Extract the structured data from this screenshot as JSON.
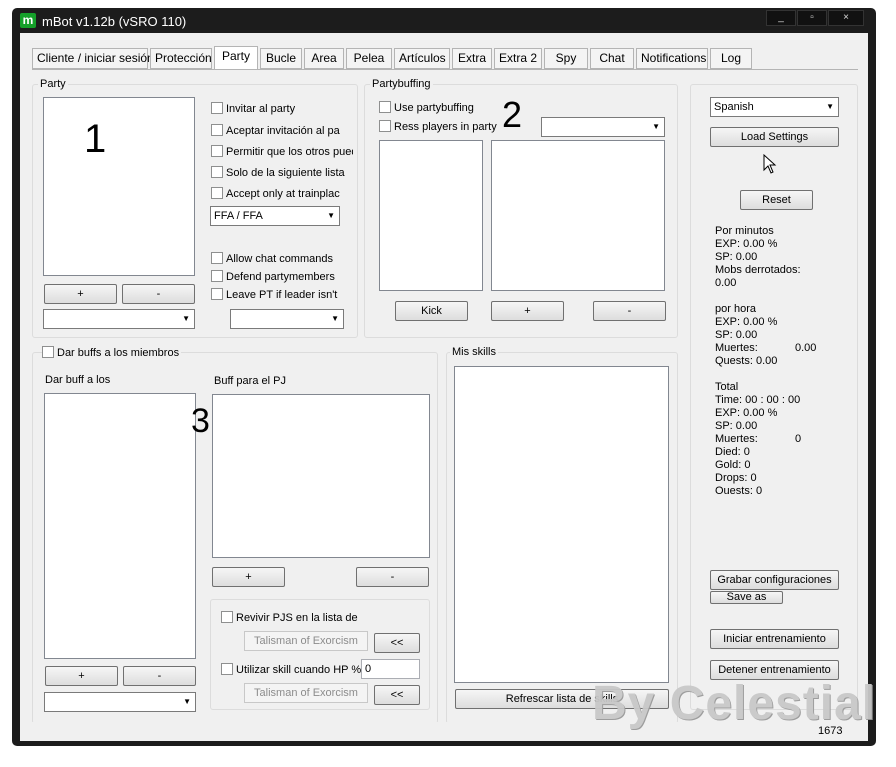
{
  "window": {
    "title": "mBot v1.12b (vSRO 110)",
    "logo": "m",
    "minimize": "_",
    "maximize": "▫",
    "close": "×"
  },
  "tabs": [
    "Cliente / iniciar sesión",
    "Protección",
    "Party",
    "Bucle",
    "Area",
    "Pelea",
    "Artículos",
    "Extra",
    "Extra 2",
    "Spy",
    "Chat",
    "Notifications",
    "Log"
  ],
  "party": {
    "group_label": "Party",
    "list_marker": "1",
    "checkboxes": [
      "Invitar al party",
      "Aceptar invitación al pa",
      "Permitir que los otros pued",
      "Solo de la siguiente lista",
      "Accept only at trainplac"
    ],
    "mode": "FFA / FFA",
    "checkboxes2": [
      "Allow chat commands",
      "Defend partymembers",
      "Leave PT if leader isn't"
    ],
    "add": "+",
    "remove": "-"
  },
  "partybuffing": {
    "group_label": "Partybuffing",
    "marker": "2",
    "use": "Use partybuffing",
    "ress": "Ress players in party",
    "kick": "Kick",
    "add": "+",
    "remove": "-"
  },
  "buffs": {
    "checkbox": "Dar buffs a los miembros",
    "left_label": "Dar buff a los",
    "right_label": "Buff para el PJ",
    "marker": "3",
    "add": "+",
    "remove": "-",
    "revive": "Revivir PJS en la lista de",
    "skill1": "Talisman of Exorcism",
    "use_skill": "Utilizar skill cuando HP %",
    "hp_value": "0",
    "skill2": "Talisman of Exorcism",
    "arrow_btn": "<<"
  },
  "skills": {
    "group_label": "Mis skills",
    "refresh": "Refrescar lista de skills"
  },
  "side": {
    "language": "Spanish",
    "load": "Load Settings",
    "reset": "Reset",
    "per_min_title": "Por minutos",
    "per_min": [
      "EXP:     0.00 %",
      "SP:       0.00",
      "Mobs derrotados:",
      "0.00"
    ],
    "per_hour_title": "por hora",
    "per_hour": [
      "EXP:     0.00 %",
      "SP:       0.00",
      "Muertes:",
      "Quests: 0.00"
    ],
    "per_hour_deaths": "0.00",
    "total_title": "Total",
    "total": [
      "Time:     00 : 00 : 00",
      "EXP:     0.00 %",
      "SP:       0.00",
      "Muertes:",
      "Died:     0",
      "Gold:     0",
      "Drops:    0",
      "Ouests: 0"
    ],
    "total_deaths": "0",
    "save_config": "Grabar configuraciones",
    "save_as": "Save as",
    "start": "Iniciar entrenamiento",
    "stop": "Detener entrenamiento"
  },
  "status": {
    "counter": "1673"
  },
  "watermark": "By Celestial"
}
